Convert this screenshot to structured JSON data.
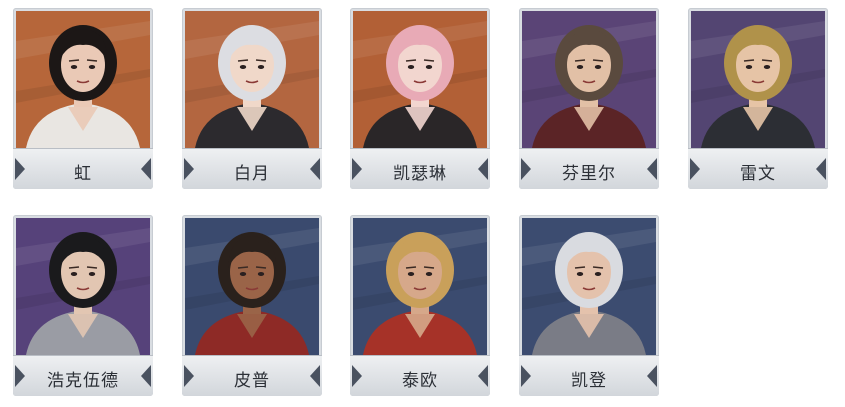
{
  "characters": [
    {
      "name": "虹",
      "bg": "#b6663a",
      "hair": "#1c1716",
      "skin": "#eac9b6",
      "outfit": "#e9e6e2",
      "icon": "portrait-hong"
    },
    {
      "name": "白月",
      "bg": "#b36640",
      "hair": "#dcdde2",
      "skin": "#f0d8c9",
      "outfit": "#2c2a2e",
      "icon": "portrait-baiyue"
    },
    {
      "name": "凯瑟琳",
      "bg": "#b26036",
      "hair": "#e8aab6",
      "skin": "#f2d6cf",
      "outfit": "#2a2628",
      "icon": "portrait-catherine"
    },
    {
      "name": "芬里尔",
      "bg": "#5a4476",
      "hair": "#5a4a3e",
      "skin": "#e2c0a6",
      "outfit": "#5b2426",
      "icon": "portrait-fenrir"
    },
    {
      "name": "雷文",
      "bg": "#534572",
      "hair": "#b0924a",
      "skin": "#e6c4a6",
      "outfit": "#2c2e34",
      "icon": "portrait-raven"
    },
    {
      "name": "浩克伍德",
      "bg": "#56427a",
      "hair": "#1a1a1c",
      "skin": "#e2c6b2",
      "outfit": "#9a9ca4",
      "icon": "portrait-hawkwood"
    },
    {
      "name": "皮普",
      "bg": "#3a4a6e",
      "hair": "#2a211c",
      "skin": "#9a6448",
      "outfit": "#8e2a26",
      "icon": "portrait-pip"
    },
    {
      "name": "泰欧",
      "bg": "#3b4b6f",
      "hair": "#c9a05a",
      "skin": "#d6a88a",
      "outfit": "#a63228",
      "icon": "portrait-teo"
    },
    {
      "name": "凯登",
      "bg": "#3c4c70",
      "hair": "#d9dbe0",
      "skin": "#e4c2ac",
      "outfit": "#7a7c86",
      "icon": "portrait-kaden"
    }
  ]
}
